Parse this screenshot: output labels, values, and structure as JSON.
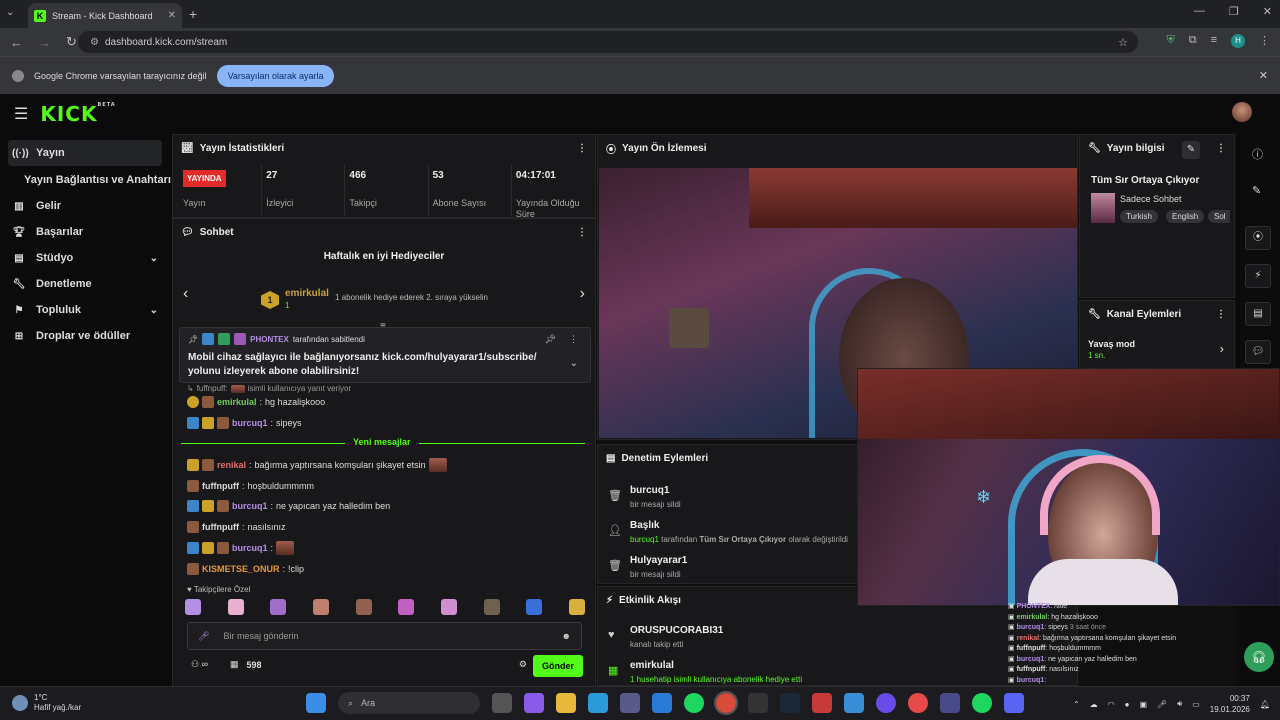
{
  "browser": {
    "tab_title": "Stream - Kick Dashboard",
    "url": "dashboard.kick.com/stream",
    "infobar_text": "Google Chrome varsayılan tarayıcınız değil",
    "infobar_button": "Varsayılan olarak ayarla",
    "profile_initial": "H"
  },
  "header": {
    "logo": "KICK",
    "beta": "BETA"
  },
  "sidebar": {
    "items": [
      {
        "label": "Yayın",
        "icon": "broadcast-icon"
      },
      {
        "label": "Yayın Bağlantısı ve Anahtarı",
        "icon": ""
      },
      {
        "label": "Gelir",
        "icon": "chart-icon"
      },
      {
        "label": "Başarılar",
        "icon": "trophy-icon"
      },
      {
        "label": "Stüdyo",
        "icon": "studio-icon"
      },
      {
        "label": "Denetleme",
        "icon": "wrench-icon"
      },
      {
        "label": "Topluluk",
        "icon": "community-icon"
      },
      {
        "label": "Droplar ve ödüller",
        "icon": "gift-icon"
      }
    ]
  },
  "stats": {
    "title": "Yayın İstatistikleri",
    "live_label": "YAYINDA",
    "status_label": "Yayın",
    "viewers": "27",
    "viewers_label": "İzleyici",
    "followers": "466",
    "followers_label": "Takipçi",
    "subs": "53",
    "subs_label": "Abone Sayısı",
    "uptime": "04:17:01",
    "uptime_label": "Yayında Olduğu Süre"
  },
  "chat": {
    "title": "Sohbet",
    "top_gifters_title": "Haftalık en iyi Hediyeciler",
    "top_gifter_rank": "1",
    "top_gifter_name": "emirkulal",
    "top_gifter_count": "1",
    "top_gifter_note": "1 abonelik hediye ederek 2. sıraya yükselin",
    "pinned_by": "PHONTEX",
    "pinned_suffix": "tarafından sabitlendi",
    "pinned_message": "Mobil cihaz sağlayıcı ile bağlanıyorsanız kick.com/hulyayarar1/subscribe/ yolunu izleyerek abone olabilirsiniz!",
    "reply_hint_user": "fuffnpuff:",
    "reply_hint_text": "isimli kullanıcıya yanıt veriyor",
    "new_messages_label": "Yeni mesajlar",
    "messages": [
      {
        "user": "emirkulal",
        "text": "hg hazalişkooo"
      },
      {
        "user": "burcuq1",
        "text": "sipeys"
      },
      {
        "user": "renikal",
        "text": "bağırma yaptırsana komşuları şikayet etsin"
      },
      {
        "user": "fuffnpuff",
        "text": "hoşbuldummmm"
      },
      {
        "user": "burcuq1",
        "text": "ne yapıcan yaz halledim ben"
      },
      {
        "user": "fuffnpuff",
        "text": "nasılsınız"
      },
      {
        "user": "burcuq1",
        "text": ""
      },
      {
        "user": "KISMETSE_ONUR",
        "text": "!clip"
      }
    ],
    "emote_header": "Takipçilere Özel",
    "input_placeholder": "Bir mesaj gönderin",
    "points": "598",
    "send_label": "Gönder"
  },
  "preview": {
    "title": "Yayın Ön İzlemesi"
  },
  "mod_actions": {
    "title": "Denetim Eylemleri",
    "items": [
      {
        "title": "burcuq1",
        "sub": "bir mesajı sildi"
      },
      {
        "title": "Başlık",
        "sub_user": "burcuq1",
        "sub_mid": "tarafından",
        "sub_bold": "Tüm Sır Ortaya Çıkıyor",
        "sub_end": "olarak değiştirildi"
      },
      {
        "title": "Hulyayarar1",
        "sub": "bir mesajı sildi"
      }
    ]
  },
  "events": {
    "title": "Etkinlik Akışı",
    "items": [
      {
        "title": "ORUSPUCORABI31",
        "sub": "kanalı takip etti"
      },
      {
        "title": "emirkulal",
        "sub": "1 husehatip isimli kullanıcıya abonelik hediye etti"
      }
    ]
  },
  "stream_info": {
    "title": "Yayın bilgisi",
    "stream_title": "Tüm Sır Ortaya Çıkıyor",
    "category": "Sadece Sohbet",
    "tags": [
      "Turkish",
      "English",
      "Sol"
    ]
  },
  "channel_actions": {
    "title": "Kanal Eylemleri",
    "slow_mode": "Yavaş mod",
    "slow_value": "1 sn."
  },
  "overlay_chat": [
    {
      "user": "PHONTEX",
      "text": ": /title"
    },
    {
      "user": "emirkulal",
      "text": ": hg hazalişkooo"
    },
    {
      "user": "burcuq1",
      "text": ": sipeys"
    },
    {
      "user": "renikal",
      "text": ": bağırma yaptırsana komşuları şikayet etsin"
    },
    {
      "user": "fuffnpuff",
      "text": ": hoşbuldummmm"
    },
    {
      "user": "burcuq1",
      "text": ": ne yapıcan yaz halledim ben"
    },
    {
      "user": "fuffnpuff",
      "text": ": nasılsınız"
    },
    {
      "user": "burcuq1",
      "text": ":"
    }
  ],
  "overlay_time_note": "3 saat önce",
  "taskbar": {
    "temp": "1°C",
    "weather": "Hafif yağ./kar",
    "search": "Ara",
    "time": "00:37",
    "date": "19.01.2026"
  },
  "colors": {
    "accent": "#53fc18",
    "live": "#e12b2b",
    "panel": "#18181b"
  }
}
